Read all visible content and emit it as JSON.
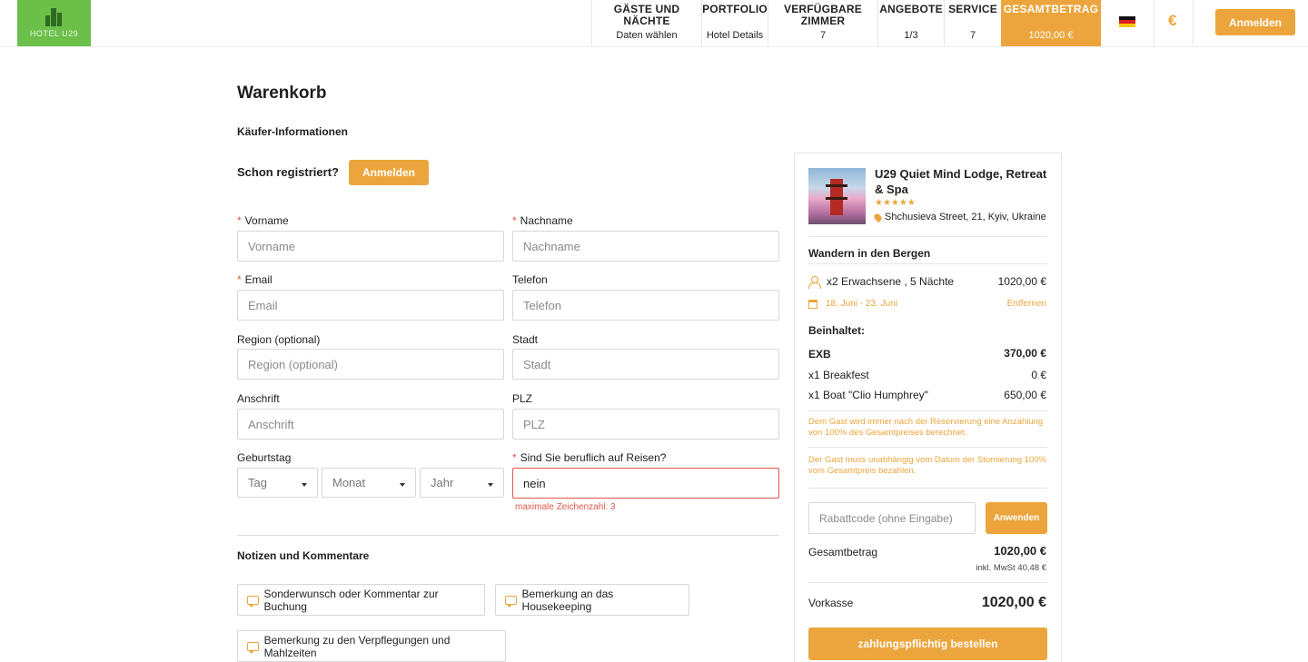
{
  "header": {
    "logo_text": "HOTEL U29",
    "nav": [
      {
        "title": "GÄSTE UND NÄCHTE",
        "sub": "Daten wählen"
      },
      {
        "title": "PORTFOLIO",
        "sub": "Hotel Details"
      },
      {
        "title": "VERFÜGBARE ZIMMER",
        "sub": "7"
      },
      {
        "title": "ANGEBOTE",
        "sub": "1/3"
      },
      {
        "title": "SERVICE",
        "sub": "7"
      },
      {
        "title": "GESAMTBETRAG",
        "sub": "1020,00 €"
      }
    ],
    "language_icon": "german-flag-icon",
    "currency": "€",
    "login_label": "Anmelden"
  },
  "main": {
    "title": "Warenkorb",
    "buyer_section": "Käufer-Informationen",
    "registered_text": "Schon registriert?",
    "login_label": "Anmelden",
    "fields": {
      "firstname": {
        "label": "Vorname",
        "placeholder": "Vorname",
        "required": "*"
      },
      "lastname": {
        "label": "Nachname",
        "placeholder": "Nachname",
        "required": "*"
      },
      "email": {
        "label": "Email",
        "placeholder": "Email",
        "required": "*"
      },
      "phone": {
        "label": "Telefon",
        "placeholder": "Telefon"
      },
      "region": {
        "label": "Region (optional)",
        "placeholder": "Region (optional)"
      },
      "city": {
        "label": "Stadt",
        "placeholder": "Stadt"
      },
      "address": {
        "label": "Anschrift",
        "placeholder": "Anschrift"
      },
      "zip": {
        "label": "PLZ",
        "placeholder": "PLZ"
      },
      "birthday": {
        "label": "Geburtstag",
        "day": "Tag",
        "month": "Monat",
        "year": "Jahr"
      },
      "business_travel": {
        "label": "Sind Sie beruflich auf Reisen?",
        "value": "nein",
        "required": "*",
        "error": "maximale Zeichenzahl: 3"
      }
    },
    "notes_title": "Notizen und Kommentare",
    "note_buttons": [
      "Sonderwunsch oder Kommentar zur Buchung",
      "Bemerkung an das Housekeeping",
      "Bemerkung zu den Verpflegungen und Mahlzeiten"
    ]
  },
  "summary": {
    "hotel_name": "U29 Quiet Mind Lodge, Retreat & Spa",
    "stars": "★★★★★",
    "address": "Shchusieva Street, 21, Kyiv, Ukraine",
    "package": "Wandern in den Bergen",
    "guests": "x2 Erwachsene , 5 Nächte",
    "guests_price": "1020,00 €",
    "dates": "18. Juni - 23. Juni",
    "remove_label": "Entfernen",
    "includes_label": "Beinhaltet:",
    "room_code": "EXB",
    "room_price": "370,00 €",
    "extras": [
      {
        "label": "x1 Breakfest",
        "price": "0 €"
      },
      {
        "label": "x1 Boat \"Clio Humphrey\"",
        "price": "650,00 €"
      }
    ],
    "notice_1": "Dem Gast wird immer nach der Reservierung eine Anzahlung von 100% des Gesamtpreises berechnet.",
    "notice_2": "Der Gast muss unabhängig vom Datum der Stornierung 100% vom Gesamtpreis bezahlen.",
    "coupon_placeholder": "Rabattcode (ohne Eingabe)",
    "apply_label": "Anwenden",
    "total_label": "Gesamtbetrag",
    "total_value": "1020,00 €",
    "vat": "inkl. MwSt 40,48 €",
    "prepay_label": "Vorkasse",
    "prepay_value": "1020,00 €",
    "order_label": "zahlungspflichtig bestellen"
  },
  "colors": {
    "accent": "#eca53c",
    "logo_green": "#6cc04a",
    "error": "#e2564a"
  }
}
